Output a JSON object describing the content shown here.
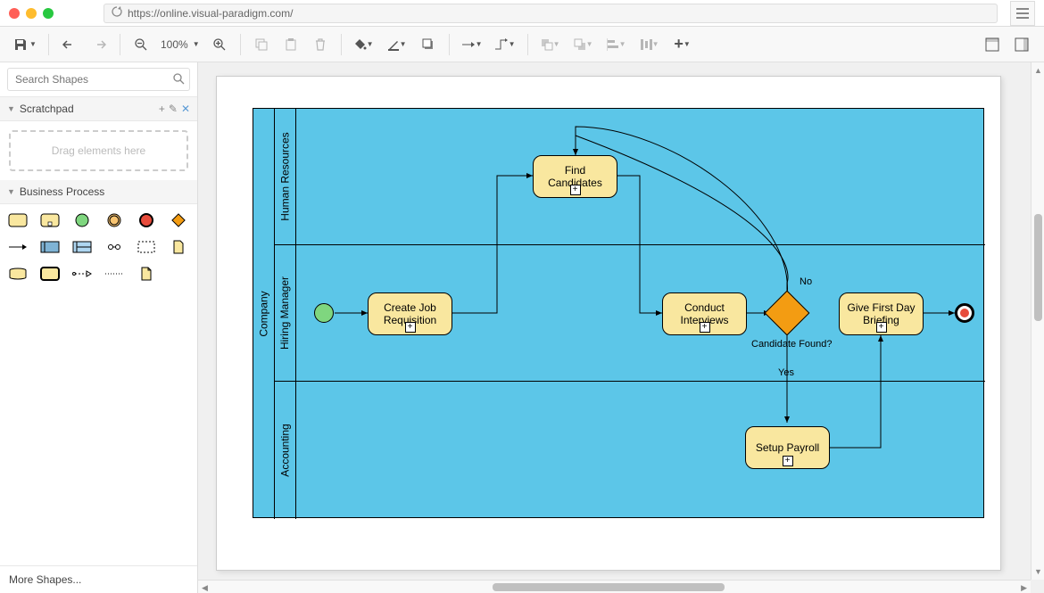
{
  "titlebar": {
    "url": "https://online.visual-paradigm.com/"
  },
  "toolbar": {
    "zoom": "100%"
  },
  "sidebar": {
    "search_placeholder": "Search Shapes",
    "scratchpad_title": "Scratchpad",
    "drop_hint": "Drag elements here",
    "palette_title": "Business Process",
    "more_shapes": "More Shapes..."
  },
  "diagram": {
    "pool": "Company",
    "lanes": [
      "Human Resources",
      "Hiring Manager",
      "Accounting"
    ],
    "tasks": {
      "create": "Create Job Requisition",
      "find": "Find Candidates",
      "conduct": "Conduct Interviews",
      "briefing": "Give First Day Briefing",
      "payroll": "Setup Payroll"
    },
    "gateway_label": "Candidate Found?",
    "edge_yes": "Yes",
    "edge_no": "No"
  }
}
